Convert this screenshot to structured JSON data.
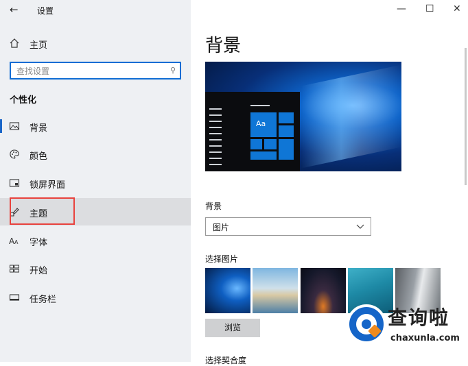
{
  "window": {
    "title": "设置",
    "back_icon": "←"
  },
  "window_controls": {
    "minimize": "—",
    "maximize": "☐",
    "close": "✕"
  },
  "sidebar": {
    "home_label": "主页",
    "search": {
      "placeholder": "查找设置"
    },
    "section_title": "个性化",
    "items": [
      {
        "label": "背景",
        "icon": "picture-icon"
      },
      {
        "label": "颜色",
        "icon": "palette-icon"
      },
      {
        "label": "锁屏界面",
        "icon": "lockscreen-icon"
      },
      {
        "label": "主题",
        "icon": "theme-icon"
      },
      {
        "label": "字体",
        "icon": "font-icon"
      },
      {
        "label": "开始",
        "icon": "start-icon"
      },
      {
        "label": "任务栏",
        "icon": "taskbar-icon"
      }
    ]
  },
  "main": {
    "page_title": "背景",
    "preview_tile_text": "Aa",
    "background_label": "背景",
    "background_value": "图片",
    "choose_picture_label": "选择图片",
    "browse_label": "浏览",
    "fit_label": "选择契合度"
  },
  "watermark": {
    "text_cn": "查询啦",
    "text_en": "chaxunla.com"
  },
  "colors": {
    "accent": "#0f6cd4",
    "highlight_box": "#e8413c"
  }
}
